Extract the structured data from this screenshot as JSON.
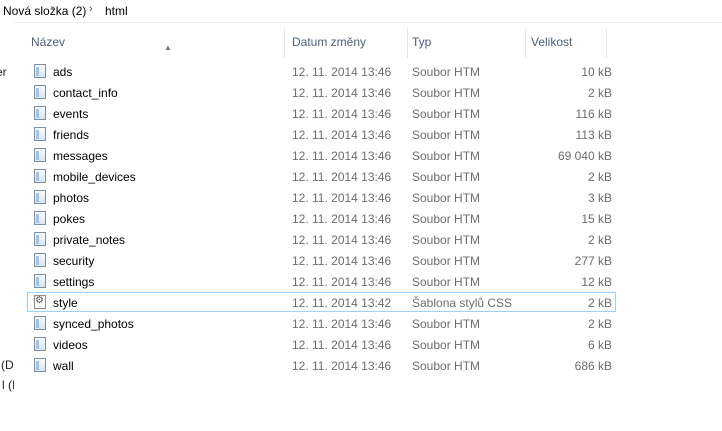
{
  "breadcrumb": {
    "folder": "Nová složka (2)",
    "current": "html",
    "separator": "›"
  },
  "nav_pane": {
    "fragments": [
      "er",
      "(D",
      "l (I"
    ]
  },
  "columns": {
    "name": "Název",
    "date": "Datum změny",
    "type": "Typ",
    "size": "Velikost"
  },
  "files": [
    {
      "name": "ads",
      "date": "12. 11. 2014 13:46",
      "type": "Soubor HTM",
      "size": "10 kB",
      "icon": "htm-file-icon"
    },
    {
      "name": "contact_info",
      "date": "12. 11. 2014 13:46",
      "type": "Soubor HTM",
      "size": "2 kB",
      "icon": "htm-file-icon"
    },
    {
      "name": "events",
      "date": "12. 11. 2014 13:46",
      "type": "Soubor HTM",
      "size": "116 kB",
      "icon": "htm-file-icon"
    },
    {
      "name": "friends",
      "date": "12. 11. 2014 13:46",
      "type": "Soubor HTM",
      "size": "113 kB",
      "icon": "htm-file-icon"
    },
    {
      "name": "messages",
      "date": "12. 11. 2014 13:46",
      "type": "Soubor HTM",
      "size": "69 040 kB",
      "icon": "htm-file-icon"
    },
    {
      "name": "mobile_devices",
      "date": "12. 11. 2014 13:46",
      "type": "Soubor HTM",
      "size": "2 kB",
      "icon": "htm-file-icon"
    },
    {
      "name": "photos",
      "date": "12. 11. 2014 13:46",
      "type": "Soubor HTM",
      "size": "3 kB",
      "icon": "htm-file-icon"
    },
    {
      "name": "pokes",
      "date": "12. 11. 2014 13:46",
      "type": "Soubor HTM",
      "size": "15 kB",
      "icon": "htm-file-icon"
    },
    {
      "name": "private_notes",
      "date": "12. 11. 2014 13:46",
      "type": "Soubor HTM",
      "size": "2 kB",
      "icon": "htm-file-icon"
    },
    {
      "name": "security",
      "date": "12. 11. 2014 13:46",
      "type": "Soubor HTM",
      "size": "277 kB",
      "icon": "htm-file-icon"
    },
    {
      "name": "settings",
      "date": "12. 11. 2014 13:46",
      "type": "Soubor HTM",
      "size": "12 kB",
      "icon": "htm-file-icon"
    },
    {
      "name": "style",
      "date": "12. 11. 2014 13:42",
      "type": "Šablona stylů CSS",
      "size": "2 kB",
      "icon": "css-file-icon",
      "selected": true
    },
    {
      "name": "synced_photos",
      "date": "12. 11. 2014 13:46",
      "type": "Soubor HTM",
      "size": "2 kB",
      "icon": "htm-file-icon"
    },
    {
      "name": "videos",
      "date": "12. 11. 2014 13:46",
      "type": "Soubor HTM",
      "size": "6 kB",
      "icon": "htm-file-icon"
    },
    {
      "name": "wall",
      "date": "12. 11. 2014 13:46",
      "type": "Soubor HTM",
      "size": "686 kB",
      "icon": "htm-file-icon"
    }
  ],
  "colors": {
    "header_text": "#4c607a",
    "selection_border": "#99d1ff",
    "secondary_text": "#6d6d6d"
  }
}
